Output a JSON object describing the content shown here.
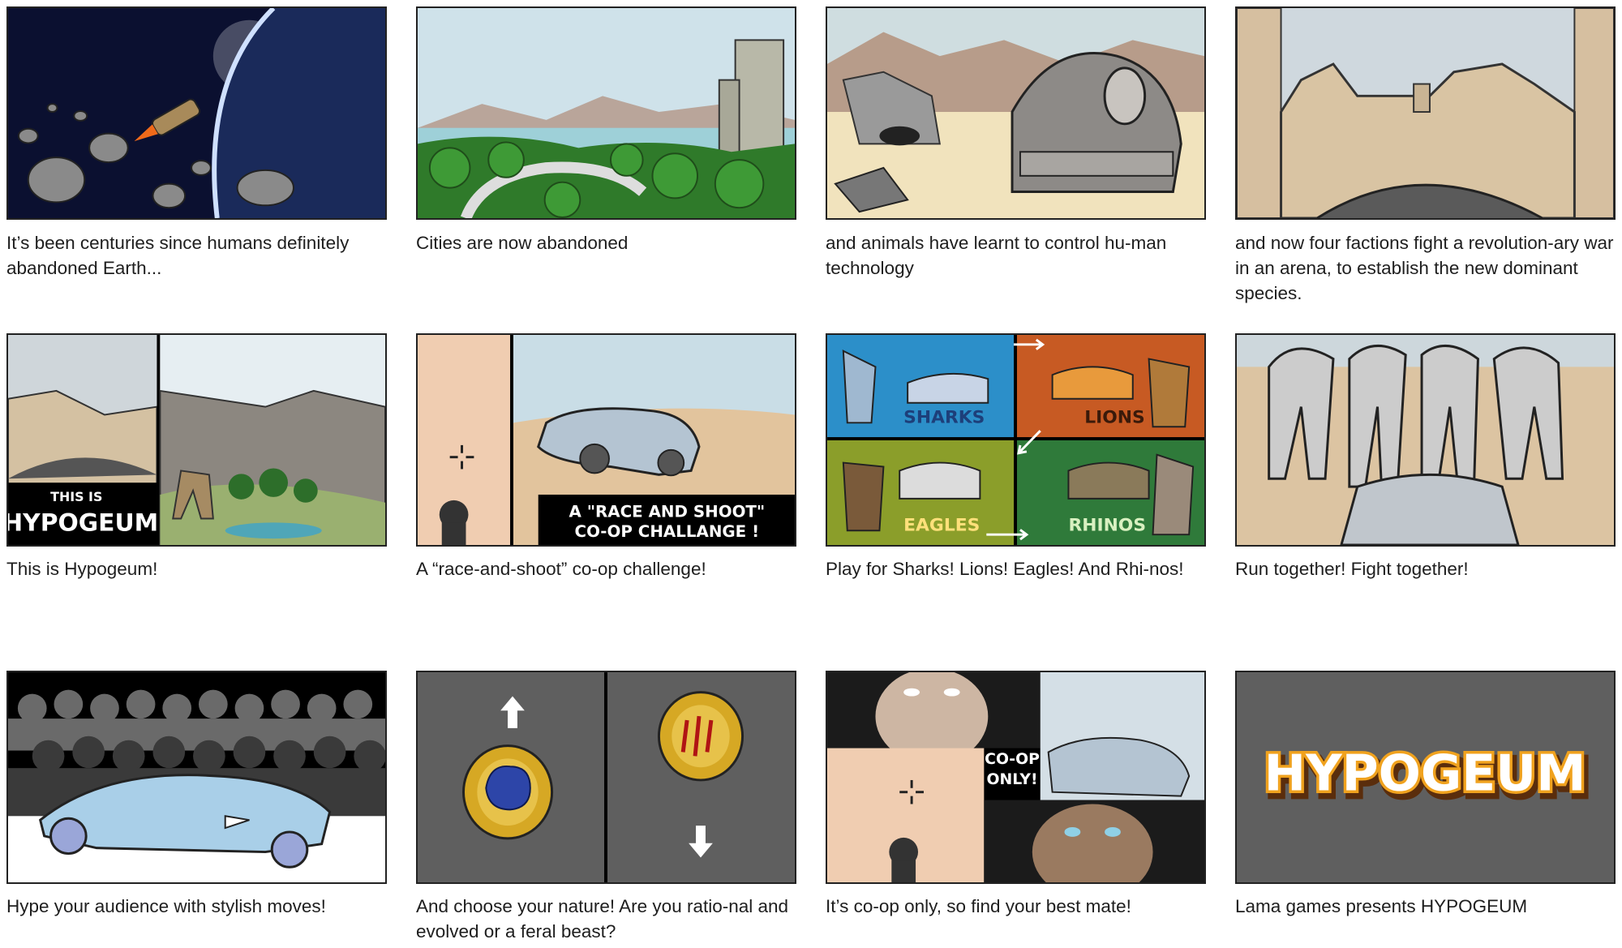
{
  "panels": [
    {
      "id": "p1",
      "caption": "It’s been centuries since humans definitely abandoned Earth..."
    },
    {
      "id": "p2",
      "caption": "Cities are now abandoned"
    },
    {
      "id": "p3",
      "caption": "and animals have learnt to control hu-man technology"
    },
    {
      "id": "p4",
      "caption": "and now four factions fight a revolution-ary war in an arena, to establish the new dominant species."
    },
    {
      "id": "p5",
      "caption": "This is Hypogeum!",
      "art_text_top": "THIS IS",
      "art_text_bottom": "HYPOGEUM"
    },
    {
      "id": "p6",
      "caption": "A “race-and-shoot” co-op challenge!",
      "art_text_line1": "A \"RACE AND SHOOT\"",
      "art_text_line2": "CO-OP CHALLANGE !"
    },
    {
      "id": "p7",
      "caption": "Play for Sharks! Lions! Eagles! And Rhi-nos!",
      "factions": [
        "SHARKS",
        "LIONS",
        "EAGLES",
        "RHINOS"
      ]
    },
    {
      "id": "p8",
      "caption": "Run together! Fight together!"
    },
    {
      "id": "p9",
      "caption": "Hype your audience with stylish moves!"
    },
    {
      "id": "p10",
      "caption": "And choose your nature! Are you ratio-nal and evolved or a feral beast?"
    },
    {
      "id": "p11",
      "caption": "It’s co-op only, so find your best mate!",
      "art_text_line1": "CO-OP",
      "art_text_line2": "ONLY!"
    },
    {
      "id": "p12",
      "caption": "Lama games presents HYPOGEUM",
      "logo_text": "HYPOGEUM"
    }
  ],
  "colors": {
    "accent": "#f0a21e",
    "logo_shadow": "#5a2d0c",
    "panel_dark": "#5f5f5f",
    "sky": "#c9dbe4",
    "sand": "#e8d6b0"
  }
}
